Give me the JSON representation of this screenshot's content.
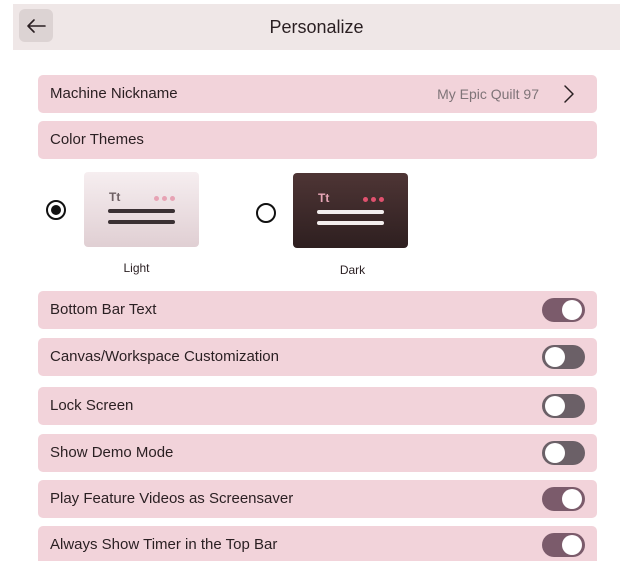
{
  "header": {
    "title": "Personalize"
  },
  "nickname": {
    "label": "Machine Nickname",
    "value": "My Epic Quilt 97"
  },
  "themes": {
    "section_label": "Color Themes",
    "options": [
      {
        "label": "Light",
        "selected": true,
        "tt": "Tt"
      },
      {
        "label": "Dark",
        "selected": false,
        "tt": "Tt"
      }
    ]
  },
  "settings": [
    {
      "label": "Bottom Bar Text",
      "on": true
    },
    {
      "label": "Canvas/Workspace Customization",
      "on": false
    },
    {
      "label": "Lock Screen",
      "on": false
    },
    {
      "label": "Show Demo Mode",
      "on": false
    },
    {
      "label": "Play Feature Videos as Screensaver",
      "on": true
    },
    {
      "label": "Always Show Timer in the Top Bar",
      "on": true
    }
  ],
  "colors": {
    "row_bg": "#f2d3da",
    "toggle_on": "#7b5b6b",
    "toggle_off": "#6b6067",
    "accent_dot": "#e0516e"
  }
}
